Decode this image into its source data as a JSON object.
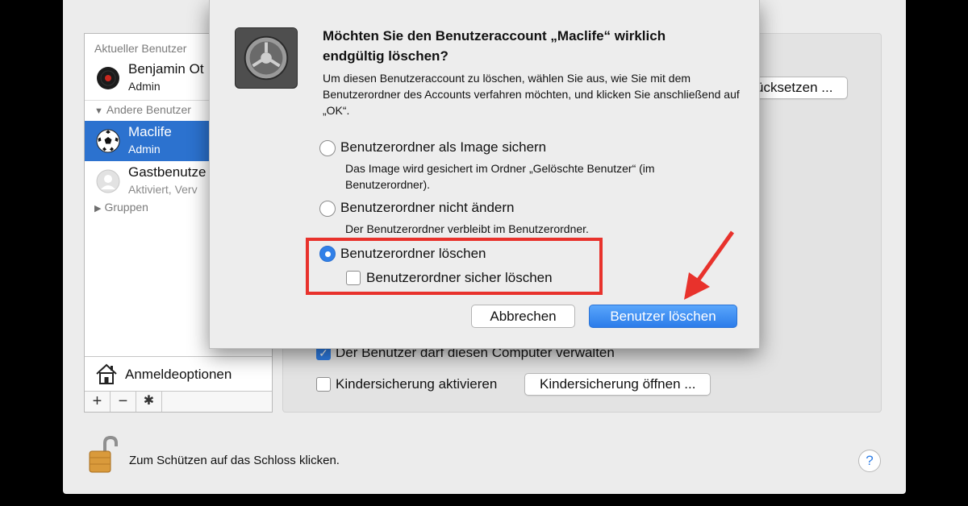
{
  "sidebar": {
    "current_label": "Aktueller Benutzer",
    "current_user": {
      "name": "Benjamin Ot",
      "role": "Admin"
    },
    "others_label": "Andere Benutzer",
    "users": [
      {
        "name": "Maclife",
        "role": "Admin"
      },
      {
        "name": "Gastbenutze",
        "role": "Aktiviert, Verv"
      }
    ],
    "groups_label": "Gruppen",
    "login_options": "Anmeldeoptionen",
    "toolbar": {
      "add": "+",
      "remove": "−",
      "gear": "✱"
    }
  },
  "background": {
    "reset_button": "ücksetzen ...",
    "admin_checkbox": "Der Benutzer darf diesen Computer verwalten",
    "parental_checkbox": "Kindersicherung aktivieren",
    "parental_button": "Kindersicherung öffnen ...",
    "lock_text": "Zum Schützen auf das Schloss klicken.",
    "help": "?"
  },
  "dialog": {
    "title": "Möchten Sie den Benutzeraccount „Maclife“ wirklich endgültig löschen?",
    "message": "Um diesen Benutzeraccount zu löschen, wählen Sie aus, wie Sie mit dem Benutzerordner des Accounts verfahren möchten, und klicken Sie anschließend auf „OK“.",
    "options": [
      {
        "label": "Benutzerordner als Image sichern",
        "desc": "Das Image wird gesichert im Ordner „Gelöschte Benutzer“ (im Benutzerordner).",
        "selected": false
      },
      {
        "label": "Benutzerordner nicht ändern",
        "desc": "Der Benutzerordner verbleibt im Benutzerordner.",
        "selected": false
      },
      {
        "label": "Benutzerordner löschen",
        "desc": "",
        "selected": true
      }
    ],
    "secure_delete": "Benutzerordner sicher löschen",
    "cancel": "Abbrechen",
    "confirm": "Benutzer löschen"
  },
  "colors": {
    "accent": "#2f7ee6",
    "highlight": "#e8322c",
    "selection": "#2c72cf"
  }
}
